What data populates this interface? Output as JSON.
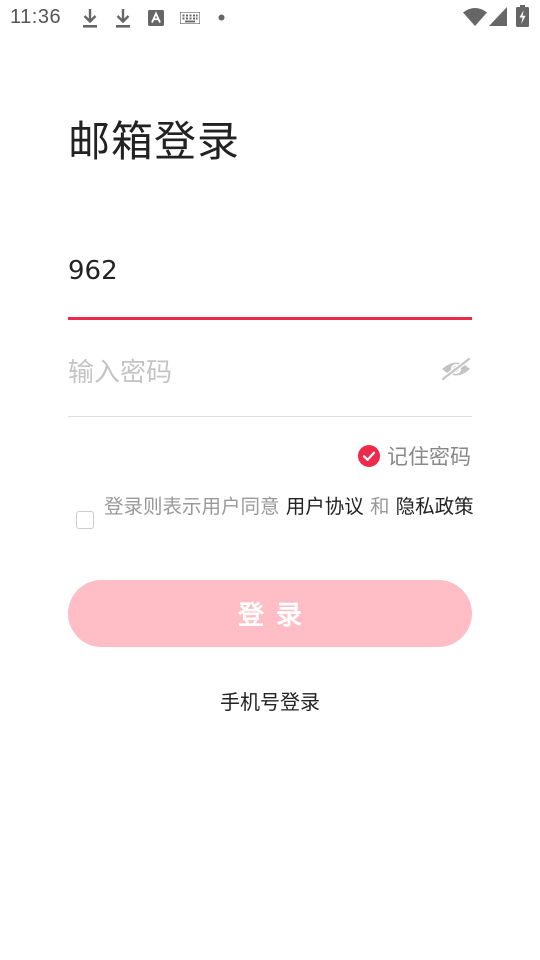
{
  "status_bar": {
    "time": "11:36",
    "icons": [
      "download-icon",
      "download-icon",
      "font-a-icon",
      "keyboard-icon",
      "dot-icon",
      "wifi-icon",
      "signal-icon",
      "battery-charging-icon"
    ]
  },
  "title": "邮箱登录",
  "email": {
    "value": "962"
  },
  "password": {
    "placeholder": "输入密码"
  },
  "remember": {
    "label": "记住密码",
    "checked": true
  },
  "agreement": {
    "checked": false,
    "prefix": "登录则表示用户同意",
    "user_agreement": "用户协议",
    "conjunction": "和",
    "privacy_policy": "隐私政策"
  },
  "login_button": {
    "label": "登录"
  },
  "phone_login": {
    "label": "手机号登录"
  },
  "colors": {
    "accent": "#ee2a4a",
    "button_disabled": "#ffbec6",
    "placeholder": "#c4c4c4",
    "muted": "#999999"
  }
}
